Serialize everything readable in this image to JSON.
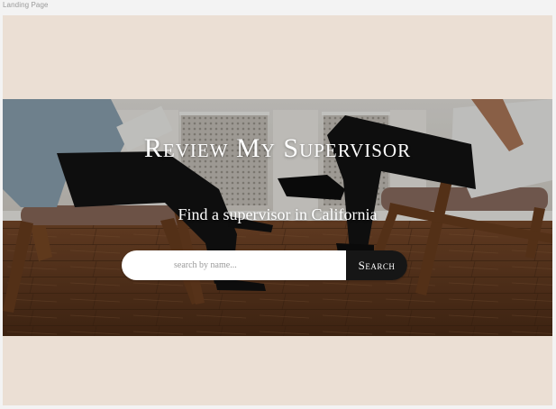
{
  "window": {
    "title": "Landing Page"
  },
  "hero": {
    "title": "Review My Supervisor",
    "subtitle": "Find a supervisor in California"
  },
  "search": {
    "placeholder": "search by name...",
    "value": "",
    "button_label": "Search"
  },
  "colors": {
    "page_background": "#ebdfd4",
    "search_button": "#161616",
    "hero_text": "#ffffff"
  }
}
